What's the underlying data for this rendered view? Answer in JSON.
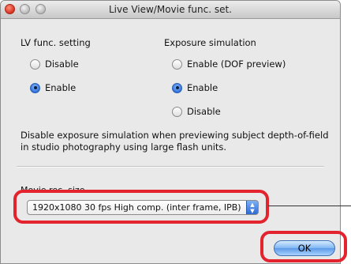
{
  "window": {
    "title": "Live View/Movie func. set."
  },
  "lv_func": {
    "heading": "LV func. setting",
    "options": [
      {
        "label": "Disable",
        "selected": false
      },
      {
        "label": "Enable",
        "selected": true
      }
    ]
  },
  "exposure_sim": {
    "heading": "Exposure simulation",
    "options": [
      {
        "label": "Enable (DOF preview)",
        "selected": false
      },
      {
        "label": "Enable",
        "selected": true
      },
      {
        "label": "Disable",
        "selected": false
      }
    ]
  },
  "description": "Disable exposure simulation when previewing subject depth-of-field in studio photography using large flash units.",
  "movie": {
    "heading": "Movie rec. size",
    "selected": "1920x1080 30 fps High comp. (inter frame, IPB)"
  },
  "buttons": {
    "ok": "OK"
  },
  "colors": {
    "highlight": "#e3232e",
    "accent": "#2b6ad6"
  }
}
